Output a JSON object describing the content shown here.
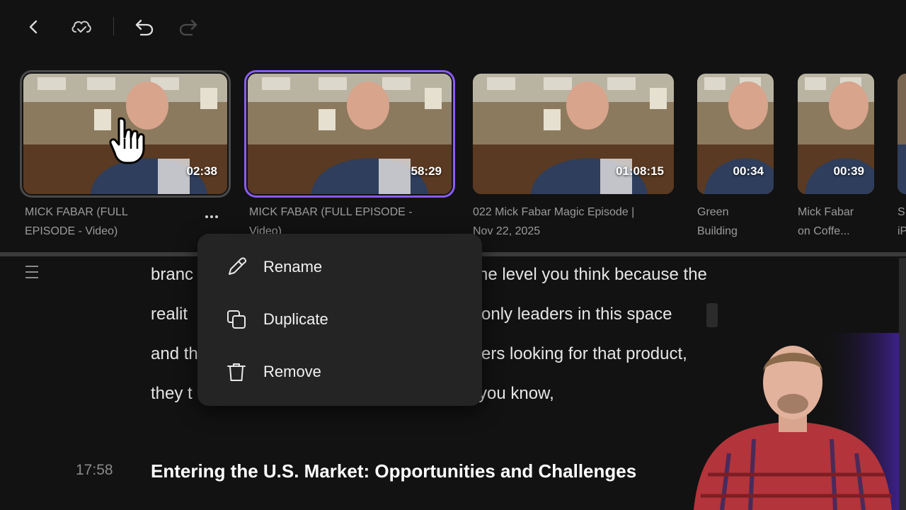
{
  "toolbar": {
    "back_icon": "chevron-left-icon",
    "cloud_icon": "cloud-check-icon",
    "undo_icon": "undo-icon",
    "redo_icon": "redo-icon"
  },
  "clips": [
    {
      "duration": "02:38",
      "title_line1": "MICK FABAR (FULL",
      "title_line2": "EPISODE - Video)"
    },
    {
      "duration": "58:29",
      "title_line1": "MICK FABAR (FULL EPISODE -",
      "title_line2": "Video)"
    },
    {
      "duration": "01:08:15",
      "title_line1": "022 Mick Fabar Magic Episode |",
      "title_line2": "Nov 22, 2025"
    },
    {
      "duration": "00:34",
      "title_line1": "Green",
      "title_line2": "Building"
    },
    {
      "duration": "00:39",
      "title_line1": "Mick Fabar",
      "title_line2": "on Coffe..."
    },
    {
      "duration": "",
      "title_line1": "S",
      "title_line2": "iP"
    }
  ],
  "context_menu": {
    "items": [
      {
        "label": "Rename",
        "icon": "pencil-icon"
      },
      {
        "label": "Duplicate",
        "icon": "duplicate-icon"
      },
      {
        "label": "Remove",
        "icon": "trash-icon"
      }
    ]
  },
  "transcript": {
    "lines": [
      {
        "left": "branc",
        "right": "he level you think because the"
      },
      {
        "left": "realit",
        "right": "only leaders in this space"
      },
      {
        "left": "and th",
        "right": "ers looking for that product,"
      },
      {
        "left": "they t",
        "right": "you know,"
      }
    ],
    "section": {
      "timestamp": "17:58",
      "heading": "Entering the U.S. Market: Opportunities and Challenges"
    }
  },
  "colors": {
    "accent": "#8a5cf6",
    "background": "#121212",
    "menu_bg": "#242424"
  }
}
